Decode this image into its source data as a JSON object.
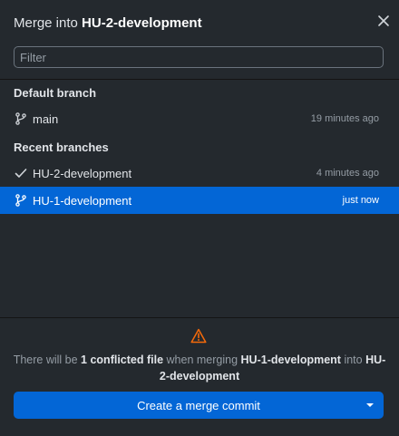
{
  "dialog": {
    "title_prefix": "Merge into",
    "title_branch": "HU-2-development"
  },
  "filter": {
    "placeholder": "Filter",
    "value": ""
  },
  "sections": {
    "default_label": "Default branch",
    "recent_label": "Recent branches"
  },
  "default_branch": {
    "name": "main",
    "time": "19 minutes ago",
    "icon": "git-branch-icon"
  },
  "recent_branches": [
    {
      "name": "HU-2-development",
      "time": "4 minutes ago",
      "icon": "check-icon",
      "selected": false
    },
    {
      "name": "HU-1-development",
      "time": "just now",
      "icon": "git-branch-icon",
      "selected": true
    }
  ],
  "merge_info": {
    "prefix": "There will be",
    "conflicts": "1 conflicted file",
    "middle": "when merging",
    "source": "HU-1-development",
    "into_word": "into",
    "target": "HU-2-development"
  },
  "button": {
    "label": "Create a merge commit"
  },
  "colors": {
    "background": "#24292e",
    "accent": "#0366d6",
    "warning": "#f66a0a",
    "text": "#e1e4e8",
    "muted": "#959da5"
  }
}
